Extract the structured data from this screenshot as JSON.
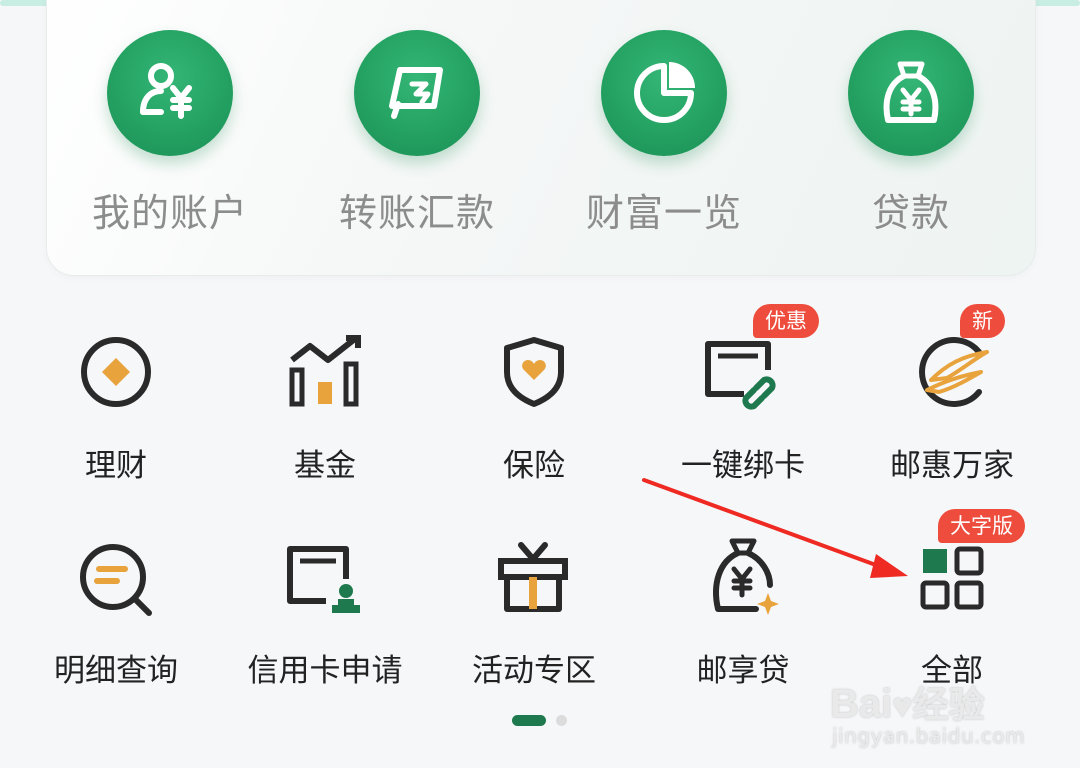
{
  "top_features": [
    {
      "label": "我的账户",
      "icon": "account-yuan-icon"
    },
    {
      "label": "转账汇款",
      "icon": "transfer-icon"
    },
    {
      "label": "财富一览",
      "icon": "wealth-pie-icon"
    },
    {
      "label": "贷款",
      "icon": "loan-bag-icon"
    }
  ],
  "services_row1": [
    {
      "label": "理财",
      "icon": "wealth-diamond-icon"
    },
    {
      "label": "基金",
      "icon": "fund-chart-icon"
    },
    {
      "label": "保险",
      "icon": "insurance-shield-icon"
    },
    {
      "label": "一键绑卡",
      "icon": "bind-card-icon",
      "badge": "优惠"
    },
    {
      "label": "邮惠万家",
      "icon": "youhui-logo-icon",
      "badge": "新"
    }
  ],
  "services_row2": [
    {
      "label": "明细查询",
      "icon": "detail-search-icon"
    },
    {
      "label": "信用卡申请",
      "icon": "credit-card-apply-icon"
    },
    {
      "label": "活动专区",
      "icon": "gift-box-icon"
    },
    {
      "label": "邮享贷",
      "icon": "money-bag-icon"
    },
    {
      "label": "全部",
      "icon": "all-grid-icon",
      "badge": "大字版"
    }
  ],
  "colors": {
    "brand_green": "#24a262",
    "dark_green": "#1e7a4e",
    "accent_orange": "#e8a33d",
    "badge_red": "#ee4c3c",
    "annotation_arrow": "#ee2a22"
  },
  "pager": {
    "pages": 2,
    "active": 1
  },
  "watermark": {
    "logo_text": "Bai",
    "logo_cn": "经验",
    "sub": "jingyan.baidu.com"
  }
}
